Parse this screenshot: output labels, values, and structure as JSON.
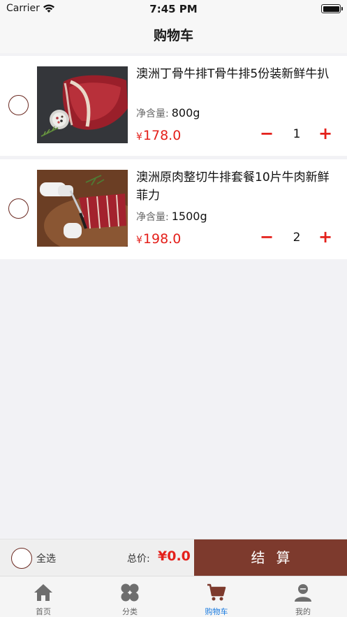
{
  "status_bar": {
    "carrier": "Carrier",
    "time": "7:45 PM"
  },
  "nav": {
    "title": "购物车"
  },
  "cart": {
    "items": [
      {
        "name": "澳洲丁骨牛排T骨牛排5份装新鲜牛扒",
        "spec_label": "净含量:",
        "spec_value": "800g",
        "currency": "¥",
        "price": "178.0",
        "quantity": "1"
      },
      {
        "name": "澳洲原肉整切牛排套餐10片牛肉新鲜菲力",
        "spec_label": "净含量:",
        "spec_value": "1500g",
        "currency": "¥",
        "price": "198.0",
        "quantity": "2"
      }
    ],
    "minus_glyph": "−",
    "plus_glyph": "+"
  },
  "footer": {
    "select_all": "全选",
    "total_label": "总价:",
    "total_value": "¥0.0",
    "checkout": "结算"
  },
  "tabs": [
    {
      "label": "首页",
      "icon": "home-icon"
    },
    {
      "label": "分类",
      "icon": "category-icon"
    },
    {
      "label": "购物车",
      "icon": "cart-icon",
      "active": true
    },
    {
      "label": "我的",
      "icon": "profile-icon"
    }
  ],
  "colors": {
    "accent": "#e4201b",
    "brand": "#7d3a2d",
    "tab_active": "#1a7be0",
    "checkbox_border": "#6b2a22"
  }
}
